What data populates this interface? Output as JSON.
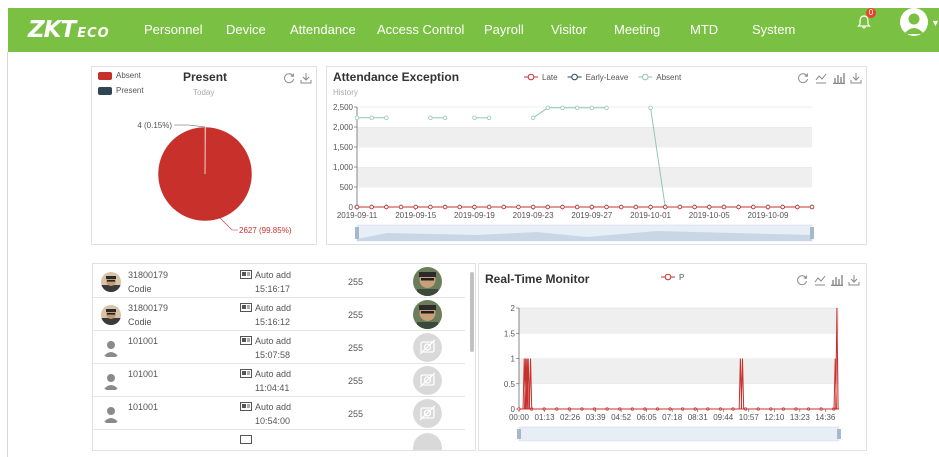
{
  "brand": {
    "logo_main": "ZKT",
    "logo_eco": "ECO"
  },
  "nav": {
    "items": [
      "Personnel",
      "Device",
      "Attendance",
      "Access Control",
      "Payroll",
      "Visitor",
      "Meeting",
      "MTD",
      "System"
    ],
    "notification_count": "0"
  },
  "present_panel": {
    "title": "Present",
    "subtitle": "Today",
    "legend": [
      {
        "label": "Absent",
        "color": "#c8302c"
      },
      {
        "label": "Present",
        "color": "#2f4554"
      }
    ],
    "icons": [
      "refresh-icon",
      "download-icon"
    ],
    "chart_data": {
      "type": "pie",
      "slices": [
        {
          "name": "Absent",
          "value": 2627,
          "label": "2627 (99.85%)",
          "color": "#c8302c"
        },
        {
          "name": "Present",
          "value": 4,
          "label": "4 (0.15%)",
          "color": "#2f4554"
        }
      ]
    }
  },
  "exception_panel": {
    "title": "Attendance Exception",
    "subtitle": "History",
    "icons": [
      "refresh-icon",
      "line-chart-icon",
      "bar-chart-icon",
      "download-icon"
    ],
    "chart_data": {
      "type": "line",
      "ylim": [
        0,
        2500
      ],
      "yticks": [
        "0",
        "500",
        "1,000",
        "1,500",
        "2,000",
        "2,500"
      ],
      "xticks": [
        "2019-09-11",
        "2019-09-15",
        "2019-09-19",
        "2019-09-23",
        "2019-09-27",
        "2019-10-01",
        "2019-10-05",
        "2019-10-09"
      ],
      "series": [
        {
          "name": "Late",
          "color": "#c8302c",
          "values": [
            0,
            0,
            0,
            0,
            0,
            0,
            0,
            0,
            0,
            0,
            0,
            0,
            0,
            0,
            0,
            0,
            0,
            0,
            0,
            0,
            0,
            0,
            0,
            0,
            0,
            0,
            0,
            0,
            0,
            0,
            0,
            0
          ]
        },
        {
          "name": "Early-Leave",
          "color": "#2f4554",
          "values": [
            0,
            0,
            0,
            0,
            0,
            0,
            0,
            0,
            0,
            0,
            0,
            0,
            0,
            0,
            0,
            0,
            0,
            0,
            0,
            0,
            0,
            0,
            0,
            0,
            0,
            0,
            0,
            0,
            0,
            0,
            0,
            0
          ]
        },
        {
          "name": "Absent",
          "color": "#91c7ae",
          "values": [
            2230,
            2230,
            2230,
            null,
            null,
            2230,
            2230,
            null,
            2230,
            2230,
            null,
            null,
            2230,
            2480,
            2480,
            2480,
            2480,
            2480,
            null,
            null,
            2480,
            0,
            0,
            0,
            0,
            0,
            0,
            0,
            0,
            0,
            0,
            0
          ]
        }
      ]
    }
  },
  "records": [
    {
      "id": "31800179",
      "name": "Codie",
      "mode": "Auto add",
      "time": "15:16:17",
      "code": "255",
      "photo": "face"
    },
    {
      "id": "31800179",
      "name": "Codie",
      "mode": "Auto add",
      "time": "15:16:12",
      "code": "255",
      "photo": "face"
    },
    {
      "id": "101001",
      "name": "",
      "mode": "Auto add",
      "time": "15:07:58",
      "code": "255",
      "photo": "none"
    },
    {
      "id": "101001",
      "name": "",
      "mode": "Auto add",
      "time": "11:04:41",
      "code": "255",
      "photo": "none"
    },
    {
      "id": "101001",
      "name": "",
      "mode": "Auto add",
      "time": "10:54:00",
      "code": "255",
      "photo": "none"
    }
  ],
  "monitor_panel": {
    "title": "Real-Time Monitor",
    "icons": [
      "refresh-icon",
      "line-chart-icon",
      "bar-chart-icon",
      "download-icon"
    ],
    "chart_data": {
      "type": "line",
      "ylim": [
        0,
        2
      ],
      "yticks": [
        "0",
        "0.5",
        "1",
        "1.5",
        "2"
      ],
      "xticks": [
        "00:00",
        "01:13",
        "02:26",
        "03:39",
        "04:52",
        "06:05",
        "07:18",
        "08:31",
        "09:44",
        "10:57",
        "12:10",
        "13:23",
        "14:36"
      ],
      "series": [
        {
          "name": "P",
          "color": "#c8302c",
          "spikes": [
            {
              "t": 0.25,
              "v": 1
            },
            {
              "t": 0.32,
              "v": 1
            },
            {
              "t": 0.38,
              "v": 1
            },
            {
              "t": 0.44,
              "v": 1
            },
            {
              "t": 0.55,
              "v": 1
            },
            {
              "t": 10.55,
              "v": 1
            },
            {
              "t": 10.65,
              "v": 1
            },
            {
              "t": 15.07,
              "v": 1
            },
            {
              "t": 15.15,
              "v": 2
            }
          ],
          "t_max": 15.25
        }
      ]
    }
  }
}
